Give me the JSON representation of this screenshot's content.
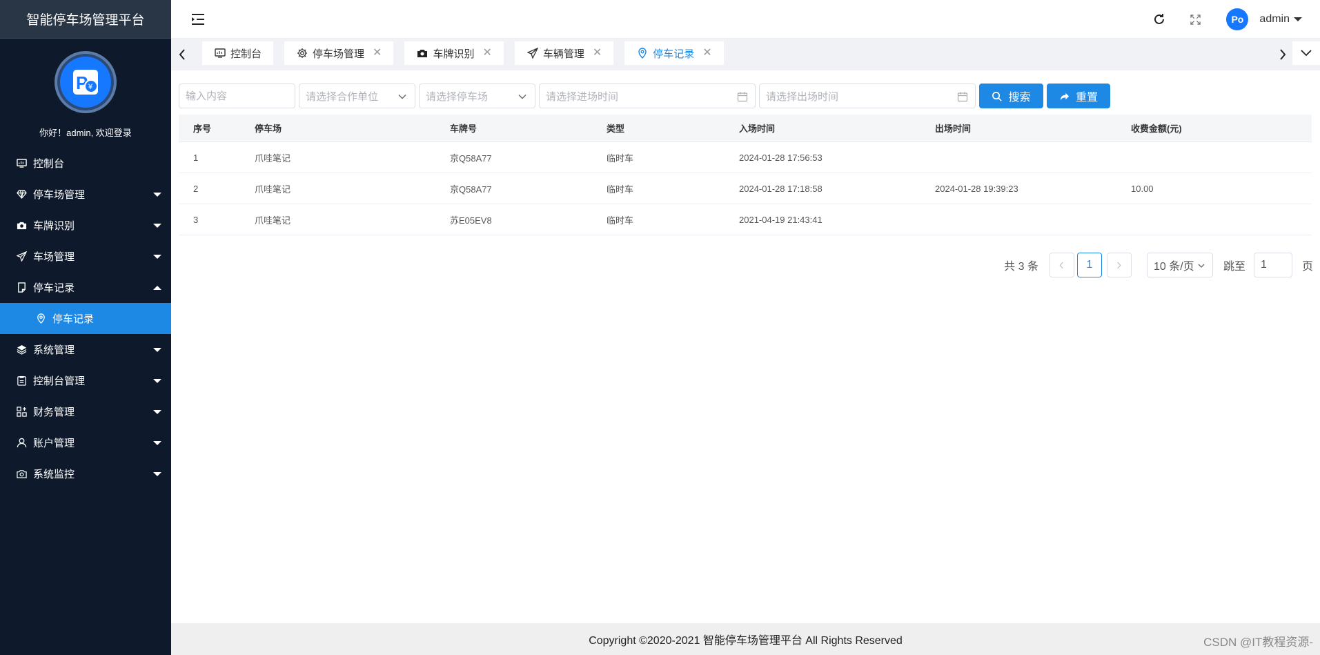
{
  "app": {
    "title": "智能停车场管理平台",
    "welcome": "你好！admin, 欢迎登录"
  },
  "sidebar": {
    "items": [
      {
        "label": "控制台",
        "icon": "monitor-icon"
      },
      {
        "label": "停车场管理",
        "icon": "diamond-icon"
      },
      {
        "label": "车牌识别",
        "icon": "camera-icon"
      },
      {
        "label": "车场管理",
        "icon": "send-icon"
      },
      {
        "label": "停车记录",
        "icon": "document-icon",
        "expanded": true
      },
      {
        "label": "停车记录",
        "icon": "location-icon",
        "sub": true,
        "active": true
      },
      {
        "label": "系统管理",
        "icon": "layers-icon"
      },
      {
        "label": "控制台管理",
        "icon": "clipboard-icon"
      },
      {
        "label": "财务管理",
        "icon": "grid-add-icon"
      },
      {
        "label": "账户管理",
        "icon": "user-icon"
      },
      {
        "label": "系统监控",
        "icon": "camera-outline-icon"
      }
    ]
  },
  "header": {
    "user": "admin",
    "avatar_text": "Po"
  },
  "tabs": [
    {
      "label": "控制台",
      "icon": "monitor-icon",
      "closable": false
    },
    {
      "label": "停车场管理",
      "icon": "gear-icon",
      "closable": true
    },
    {
      "label": "车牌识别",
      "icon": "camera-icon",
      "closable": true
    },
    {
      "label": "车辆管理",
      "icon": "send-icon",
      "closable": true
    },
    {
      "label": "停车记录",
      "icon": "location-icon",
      "closable": true,
      "active": true
    }
  ],
  "filters": {
    "keyword_placeholder": "输入内容",
    "partner_placeholder": "请选择合作单位",
    "parking_placeholder": "请选择停车场",
    "entry_time_placeholder": "请选择进场时间",
    "exit_time_placeholder": "请选择出场时间",
    "search_label": "搜索",
    "reset_label": "重置"
  },
  "table": {
    "headers": [
      "序号",
      "停车场",
      "车牌号",
      "类型",
      "入场时间",
      "出场时间",
      "收费金额(元)"
    ],
    "rows": [
      [
        "1",
        "爪哇笔记",
        "京Q58A77",
        "临时车",
        "2024-01-28 17:56:53",
        "",
        ""
      ],
      [
        "2",
        "爪哇笔记",
        "京Q58A77",
        "临时车",
        "2024-01-28 17:18:58",
        "2024-01-28 19:39:23",
        "10.00"
      ],
      [
        "3",
        "爪哇笔记",
        "苏E05EV8",
        "临时车",
        "2021-04-19 21:43:41",
        "",
        ""
      ]
    ]
  },
  "pagination": {
    "total": "共 3 条",
    "current": "1",
    "page_size": "10 条/页",
    "goto_label": "跳至",
    "goto_value": "1",
    "page_suffix": "页"
  },
  "footer": {
    "copyright": "Copyright ©2020-2021 智能停车场管理平台 All Rights Reserved",
    "watermark": "CSDN @IT教程资源-"
  },
  "colors": {
    "sidebar_bg": "#0e1a2b",
    "accent": "#1e88e5"
  }
}
